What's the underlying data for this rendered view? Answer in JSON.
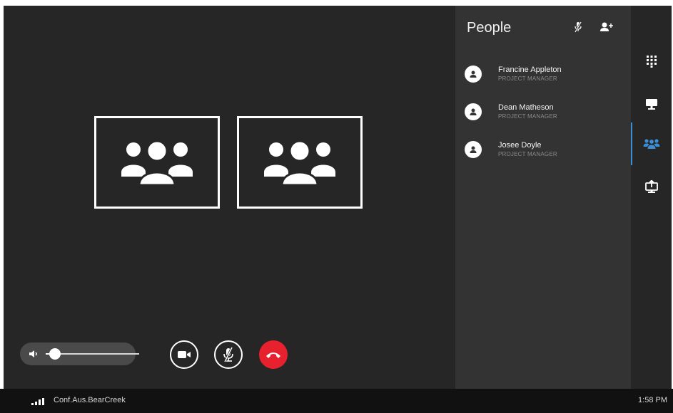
{
  "people_panel": {
    "title": "People",
    "people": [
      {
        "name": "Francine Appleton",
        "role": "PROJECT MANAGER"
      },
      {
        "name": "Dean Matheson",
        "role": "PROJECT MANAGER"
      },
      {
        "name": "Josee Doyle",
        "role": "PROJECT MANAGER"
      }
    ]
  },
  "controls": {
    "volume_level": 0.1
  },
  "rail": {
    "items": [
      "dialpad-icon",
      "monitor-icon",
      "people-icon",
      "share-screen-icon"
    ],
    "active": "people-icon"
  },
  "status_bar": {
    "room_name": "Conf.Aus.BearCreek",
    "time": "1:58 PM"
  },
  "colors": {
    "background": "#262626",
    "panel": "#333333",
    "accent": "#3a8fd6",
    "hangup": "#e8212e",
    "status_bar": "#111111"
  }
}
